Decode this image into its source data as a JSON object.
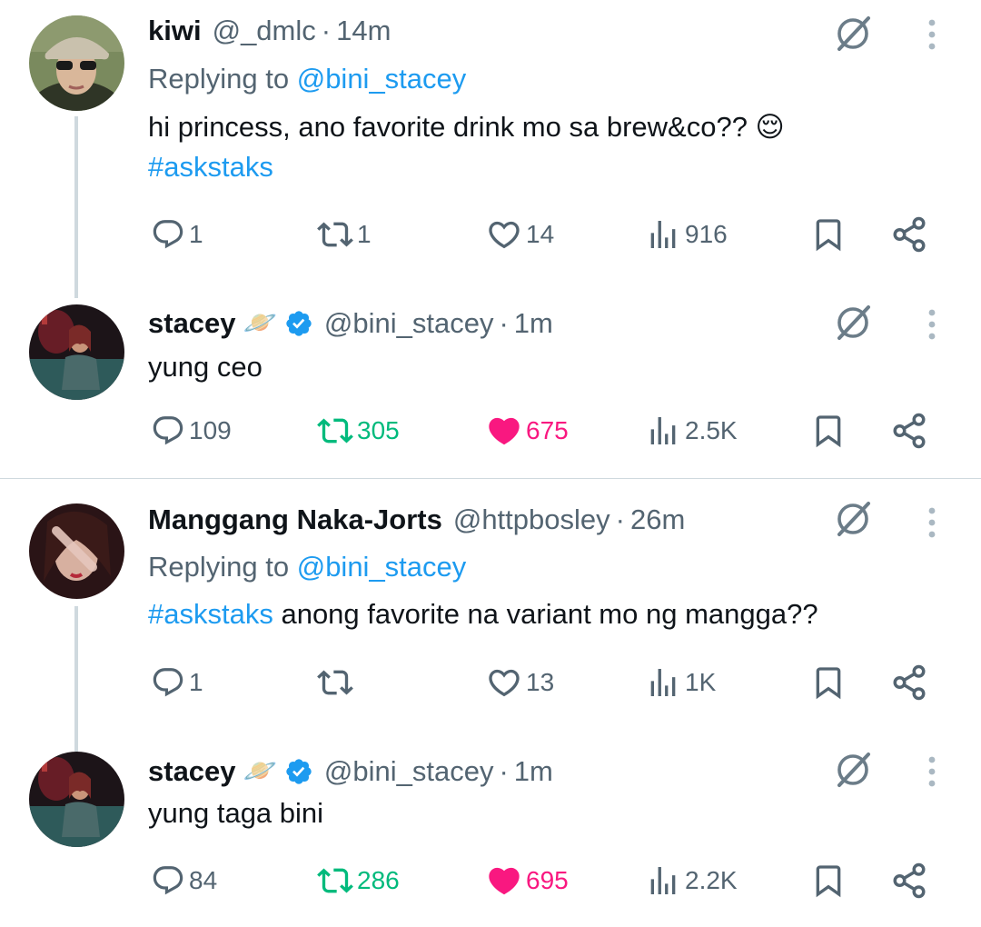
{
  "threads": [
    {
      "question": {
        "name": "kiwi",
        "handle": "@_dmlc",
        "time": "14m",
        "replying_label": "Replying to ",
        "replying_to": "@bini_stacey",
        "text": "hi princess, ano favorite drink mo sa brew&co?? 😌",
        "hashtag": "#askstaks",
        "stats": {
          "replies": "1",
          "reposts": "1",
          "likes": "14",
          "views": "916"
        }
      },
      "answer": {
        "name": "stacey",
        "emoji": "🪐",
        "handle": "@bini_stacey",
        "time": "1m",
        "text": "yung ceo",
        "stats": {
          "replies": "109",
          "reposts": "305",
          "likes": "675",
          "views": "2.5K"
        }
      }
    },
    {
      "question": {
        "name": "Manggang Naka-Jorts",
        "handle": "@httpbosley",
        "time": "26m",
        "replying_label": "Replying to ",
        "replying_to": "@bini_stacey",
        "hashtag": "#askstaks",
        "text": " anong favorite na variant mo ng mangga??",
        "stats": {
          "replies": "1",
          "reposts": "",
          "likes": "13",
          "views": "1K"
        }
      },
      "answer": {
        "name": "stacey",
        "emoji": "🪐",
        "handle": "@bini_stacey",
        "time": "1m",
        "text": "yung taga bini",
        "stats": {
          "replies": "84",
          "reposts": "286",
          "likes": "695",
          "views": "2.2K"
        }
      }
    }
  ],
  "separator": "·",
  "colors": {
    "accent": "#1d9bf0",
    "muted": "#536471",
    "repost_active": "#00ba7c",
    "like_active": "#f91880",
    "line": "#cfd9de"
  },
  "icons": [
    "reply-icon",
    "repost-icon",
    "like-icon",
    "views-icon",
    "bookmark-icon",
    "share-icon",
    "grok-icon",
    "more-icon",
    "verified-badge-icon"
  ]
}
